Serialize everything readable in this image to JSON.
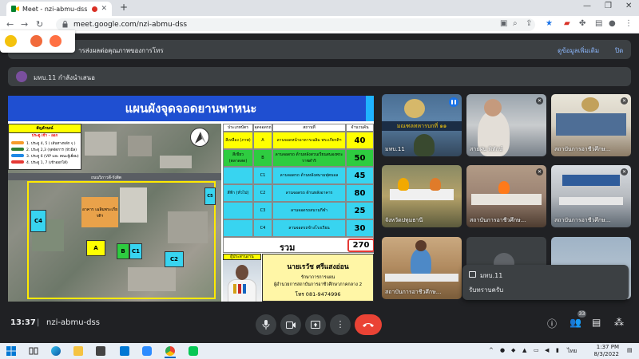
{
  "browser": {
    "tab_title": "Meet - nzi-abmu-dss",
    "tab_close": "✕",
    "new_tab": "+",
    "url": "meet.google.com/nzi-abmu-dss"
  },
  "banner": {
    "text": "ารส่งผลต่อคุณภาพของการโทร",
    "more_label": "ดูข้อมูลเพิ่มเติม",
    "close_label": "ปิด"
  },
  "presenter": {
    "label": "มทบ.11 กำลังนำเสนอ"
  },
  "slide": {
    "title": "แผนผังจุดจอดยานพาหนะ",
    "legend": {
      "header": "สัญลักษณ์",
      "gate": "ประตู เข้า - ออก",
      "routes": [
        {
          "text": "1. ประตู 4, 5 ( เส้นทางหลัก ๆ )",
          "color": "#f59b2b"
        },
        {
          "text": "2. ประตู 2,3 (จุดจัดการ (หัวมิล)",
          "color": "#2e7d32"
        },
        {
          "text": "3. ประตู 6 (VIP และ คณะผู้เยี่ยม)",
          "color": "#1e88e5"
        },
        {
          "text": "4. ประตู 1, 7 (เข้าออกได้)",
          "color": "#e53935"
        }
      ]
    },
    "map": {
      "road_label": "ถนนวิภาวดี-รังสิต",
      "building_label": "อาคาร เฉลิมพระเกียรติฯ",
      "zones": {
        "a": "A",
        "b": "B",
        "c1": "C1",
        "c2": "C2",
        "c4": "C4",
        "c5": "C5"
      }
    },
    "table": {
      "headers": [
        "ประเภทบัตร",
        "จุดจอดรถ",
        "สถานที่",
        "จำนวนคัน"
      ],
      "rows": [
        {
          "type": "สีเหลือง (ภาพ)",
          "point": "A",
          "place": "ลานจอดหน้าอาคารเฉลิม พระเกียรติฯ",
          "count": "40",
          "color": "#ffff00"
        },
        {
          "type": "สีเขียว (ตลาดสด)",
          "point": "B",
          "place": "ลานจอดรถ ด้านหลังสวนเรียนสนองพระราชดำริ",
          "count": "50",
          "color": "#2ecc40"
        },
        {
          "type": "",
          "point": "C1",
          "place": "ลานจอดรถ ด้านหลังสนามฟุตบอล",
          "count": "45",
          "color": "#38d4f0"
        },
        {
          "type": "สีฟ้า (ทั่วไป)",
          "point": "C2",
          "place": "ลานจอดรถ ด้านหลังอาคาร",
          "count": "80",
          "color": "#38d4f0"
        },
        {
          "type": "",
          "point": "C3",
          "place": "ลานจอดรถสนามกีฬา",
          "count": "25",
          "color": "#38d4f0"
        },
        {
          "type": "",
          "point": "C4",
          "place": "ลานจอดรถข้างโรงเรียน",
          "count": "30",
          "color": "#38d4f0"
        }
      ],
      "total_label": "รวม",
      "total_value": "270"
    },
    "coordinator": {
      "label": "ผู้ประสานงาน",
      "name": "นายเรวัช ศรีแสงอ่อน",
      "role1": "รักษาการการแผน",
      "role2": "ผู้อำนวยการสถาบันการอาชีวศึกษาภาคกลาง 2",
      "phone": "โทร 081-9474996"
    }
  },
  "participants": [
    {
      "name": "มทบ.11"
    },
    {
      "name": "สายฝน พิทักษ์"
    },
    {
      "name": "สถาบันการอาชีวศึกษ..."
    },
    {
      "name": "จังหวัดปทุมธานี"
    },
    {
      "name": "สถาบันการอาชีวศึกษ..."
    },
    {
      "name": "สถาบันการอาชีวศึกษ..."
    },
    {
      "name": "สถาบันการอาชีวศึกษ..."
    }
  ],
  "chat_popup": {
    "sender": "มทบ.11",
    "message": "รับทราบครับ"
  },
  "meeting": {
    "time": "13:37",
    "separator": "|",
    "code": "nzi-abmu-dss",
    "participant_count": "33"
  },
  "taskbar": {
    "language": "ไทย",
    "time": "1:37 PM",
    "date": "8/3/2022"
  },
  "colors": {
    "slide_title_bg": "#1f4fd1",
    "hangup": "#ea4335",
    "meet_bg": "#202124"
  }
}
